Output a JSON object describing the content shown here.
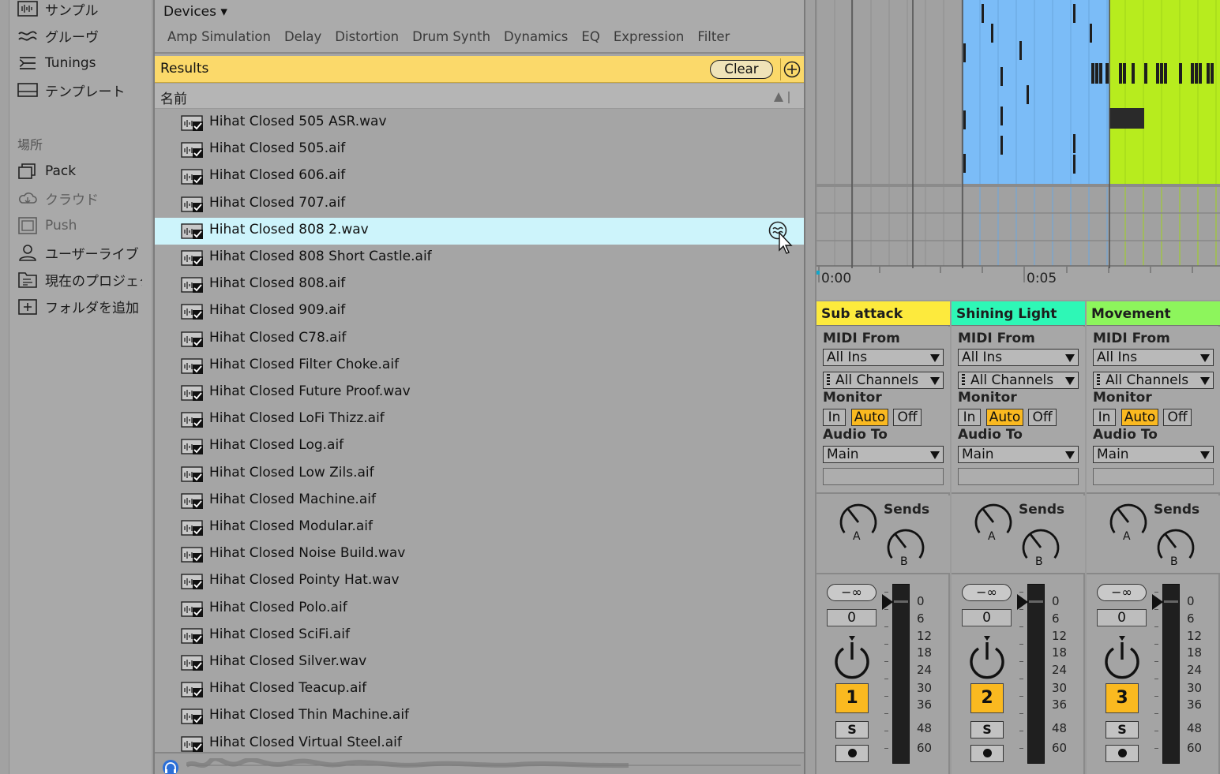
{
  "sidebar": {
    "categories": [
      {
        "label": "サンプル",
        "icon": "sample-icon"
      },
      {
        "label": "グルーヴ",
        "icon": "groove-icon"
      },
      {
        "label": "Tunings",
        "icon": "tunings-icon"
      },
      {
        "label": "テンプレート",
        "icon": "template-icon"
      }
    ],
    "places_heading": "場所",
    "places": [
      {
        "label": "Pack",
        "icon": "pack-icon"
      },
      {
        "label": "クラウド",
        "icon": "cloud-icon"
      },
      {
        "label": "Push",
        "icon": "push-icon"
      },
      {
        "label": "ユーザーライブ",
        "icon": "user-icon"
      },
      {
        "label": "現在のプロジェクト",
        "icon": "project-icon"
      },
      {
        "label": "フォルダを追加",
        "icon": "add-folder-icon"
      }
    ]
  },
  "browser": {
    "header_title": "Devices ▾",
    "device_tabs": [
      "Amp Simulation",
      "Delay",
      "Distortion",
      "Drum Synth",
      "Dynamics",
      "EQ",
      "Expression",
      "Filter"
    ],
    "results_label": "Results",
    "clear_label": "Clear",
    "column_name": "名前",
    "selected_index": 4,
    "files": [
      "Hihat Closed 505 ASR.wav",
      "Hihat Closed 505.aif",
      "Hihat Closed 606.aif",
      "Hihat Closed 707.aif",
      "Hihat Closed 808 2.wav",
      "Hihat Closed 808 Short Castle.aif",
      "Hihat Closed 808.aif",
      "Hihat Closed 909.aif",
      "Hihat Closed C78.aif",
      "Hihat Closed Filter Choke.aif",
      "Hihat Closed Future Proof.wav",
      "Hihat Closed LoFi Thizz.aif",
      "Hihat Closed Log.aif",
      "Hihat Closed Low Zils.aif",
      "Hihat Closed Machine.aif",
      "Hihat Closed Modular.aif",
      "Hihat Closed Noise Build.wav",
      "Hihat Closed Pointy Hat.wav",
      "Hihat Closed Polo.aif",
      "Hihat Closed SciFi.aif",
      "Hihat Closed Silver.wav",
      "Hihat Closed Teacup.aif",
      "Hihat Closed Thin Machine.aif",
      "Hihat Closed Virtual Steel.aif"
    ]
  },
  "arrangement": {
    "ruler": [
      "0:00",
      "0:05"
    ],
    "clip_colors": [
      "#7bbcf7",
      "#b7ec1e"
    ]
  },
  "mixer": {
    "labels": {
      "midi_from": "MIDI From",
      "monitor": "Monitor",
      "audio_to": "Audio To",
      "sends": "Sends",
      "send_a": "A",
      "send_b": "B",
      "mon_in": "In",
      "mon_auto": "Auto",
      "mon_off": "Off",
      "neg_inf": "−∞",
      "solo": "S"
    },
    "db_scale": [
      "0",
      "6",
      "12",
      "18",
      "24",
      "30",
      "36",
      "48",
      "60"
    ],
    "tracks": [
      {
        "name": "Sub attack",
        "color": "#fdea3d",
        "midi_from": "All Ins",
        "channel": "All Channels",
        "audio_to": "Main",
        "volume": "0",
        "number": "1"
      },
      {
        "name": "Shining Light",
        "color": "#2ef7b6",
        "midi_from": "All Ins",
        "channel": "All Channels",
        "audio_to": "Main",
        "volume": "0",
        "number": "2"
      },
      {
        "name": "Movement",
        "color": "#8df55c",
        "midi_from": "All Ins",
        "channel": "All Channels",
        "audio_to": "Main",
        "volume": "0",
        "number": "3"
      }
    ]
  }
}
